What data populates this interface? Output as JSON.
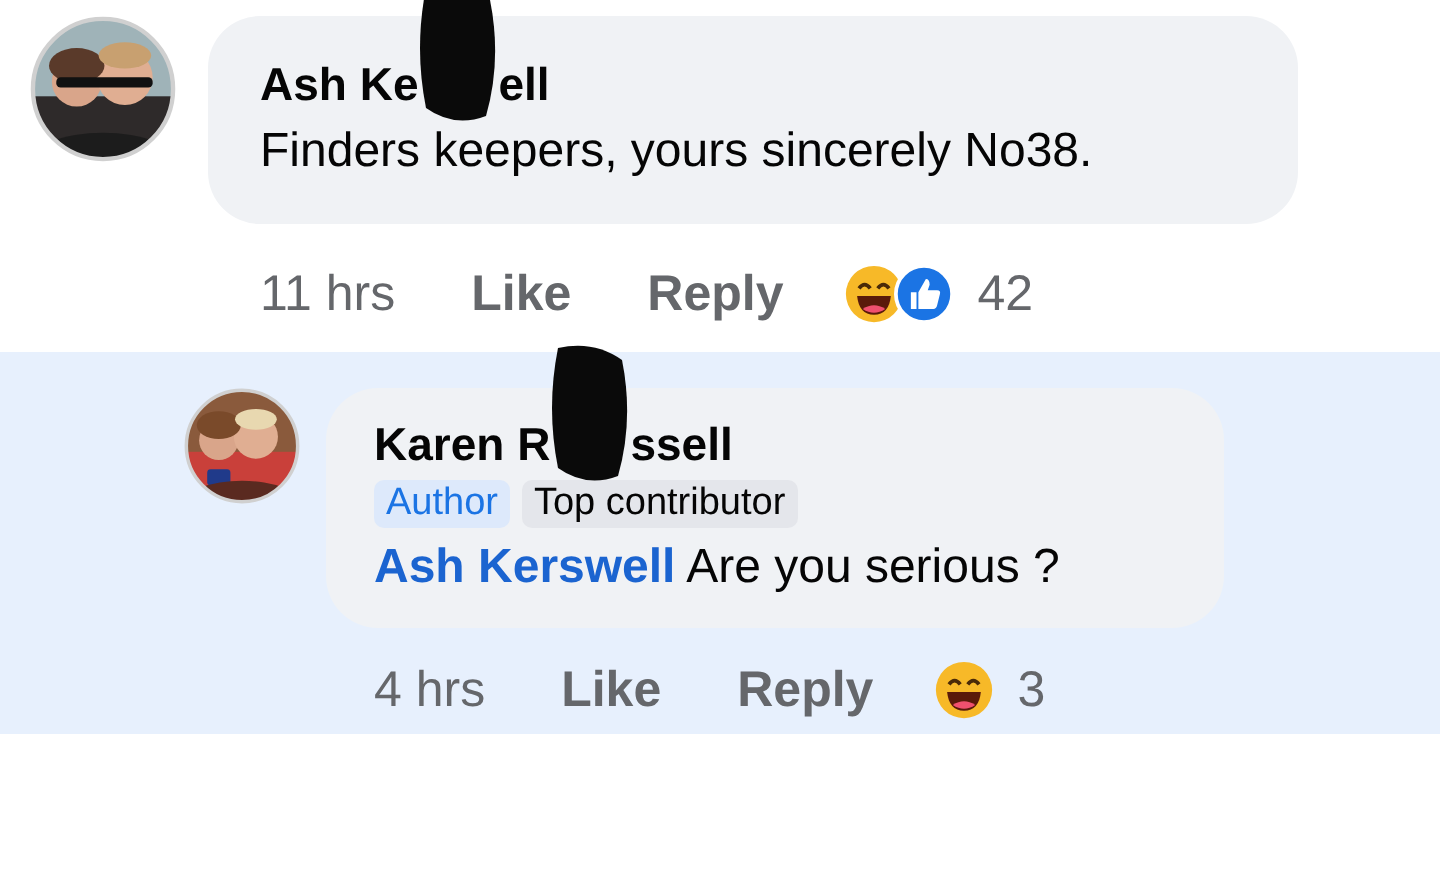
{
  "comments": [
    {
      "name_parts": [
        "Ash Ke",
        "ell"
      ],
      "avatar": {
        "kind": "picture"
      },
      "text": "Finders keepers, yours sincerely No38.",
      "time": "11 hrs",
      "actions": [
        "Like",
        "Reply"
      ],
      "reactions": [
        {
          "kind": "haha"
        },
        {
          "kind": "like"
        }
      ],
      "reaction_count": "42",
      "highlighted": false
    },
    {
      "name_parts": [
        "Karen R",
        "ssell"
      ],
      "avatar": {
        "kind": "picture"
      },
      "badges": [
        {
          "label": "Author",
          "kind": "author"
        },
        {
          "label": "Top contributor",
          "kind": "plain"
        }
      ],
      "mention": "Ash Kerswell",
      "text": "Are you serious ?",
      "time": "4 hrs",
      "actions": [
        "Like",
        "Reply"
      ],
      "reactions": [
        {
          "kind": "haha"
        }
      ],
      "reaction_count": "3",
      "highlighted": true
    }
  ]
}
